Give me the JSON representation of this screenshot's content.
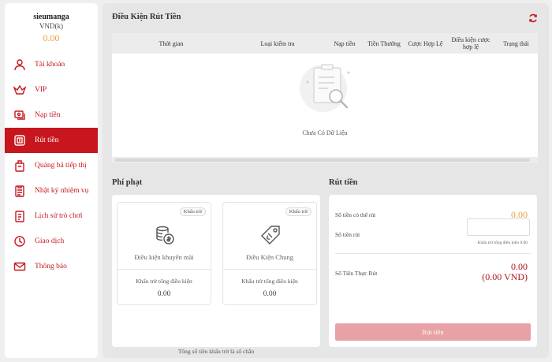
{
  "user": {
    "username": "sieumanga",
    "currency": "VND(k)",
    "balance": "0.00"
  },
  "sidebar": {
    "items": [
      {
        "label": "Tài khoản",
        "icon": "user-icon"
      },
      {
        "label": "VIP",
        "icon": "vip-icon"
      },
      {
        "label": "Nạp tiền",
        "icon": "deposit-icon"
      },
      {
        "label": "Rút tiền",
        "icon": "withdraw-icon",
        "active": true
      },
      {
        "label": "Quảng bá tiếp thị",
        "icon": "promotion-icon"
      },
      {
        "label": "Nhật ký nhiệm vụ",
        "icon": "clipboard-icon"
      },
      {
        "label": "Lịch sử trò chơi",
        "icon": "history-icon"
      },
      {
        "label": "Giao dịch",
        "icon": "clock-icon"
      },
      {
        "label": "Thông báo",
        "icon": "mail-icon"
      }
    ]
  },
  "conditions": {
    "title": "Điều Kiện Rút Tiền",
    "columns": [
      "Thời gian",
      "Loại kiểm tra",
      "Nạp tiền",
      "Tiền Thưởng",
      "Cược Hợp Lệ",
      "Điều kiện cược hợp lệ",
      "Trạng thái"
    ],
    "empty_text": "Chưa Có Dữ Liệu"
  },
  "penalty": {
    "title": "Phí phạt",
    "cards": [
      {
        "tag": "Khấu trừ",
        "title": "Điều kiện khuyến mãi",
        "subtitle": "Khấu trừ tổng điều kiện",
        "value": "0.00"
      },
      {
        "tag": "Khấu trừ",
        "title": "Điều Kiện Chung",
        "subtitle": "Khấu trừ tổng điều kiện",
        "value": "0.00"
      }
    ],
    "total_note": "Tổng số tiền khấu trừ là số chẵn"
  },
  "withdraw": {
    "title": "Rút tiền",
    "available_label": "Số tiền có thể rút",
    "available_value": "0.00",
    "amount_label": "Số tiền rút",
    "amount_value": "",
    "hint": "Khấu trừ tổng điều kiện 0.00",
    "actual_label": "Số Tiền Thực Rút",
    "actual_value": "0.00",
    "actual_vnd": "(0.00 VND)",
    "button": "Rút tiền"
  },
  "colors": {
    "accent": "#c7161e",
    "balance": "#e6a23c",
    "button_disabled": "#e8a2a5"
  }
}
